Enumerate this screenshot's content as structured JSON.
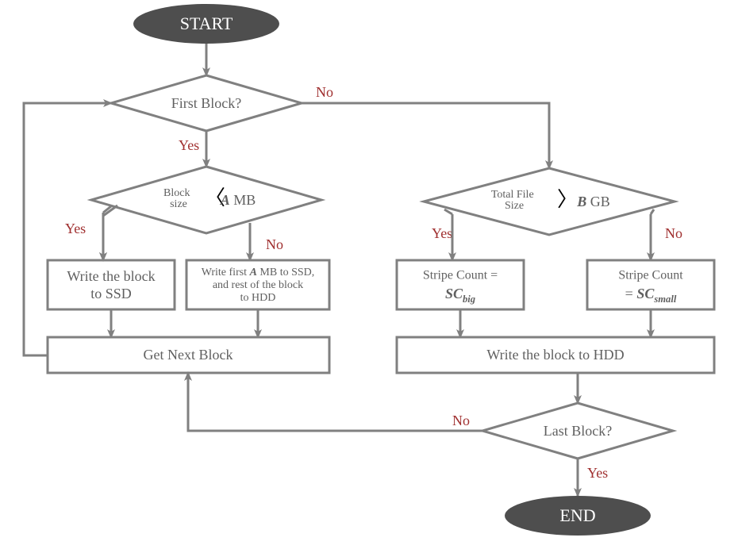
{
  "flowchart": {
    "start": "START",
    "end": "END",
    "decisions": {
      "first_block": "First Block?",
      "block_size_l1": "Block",
      "block_size_l2": "size",
      "block_size_var": "A",
      "block_size_unit": "MB",
      "total_file_l1": "Total File",
      "total_file_l2": "Size",
      "total_file_var": "B",
      "total_file_unit": "GB",
      "last_block": "Last Block?"
    },
    "processes": {
      "write_ssd_l1": "Write the block",
      "write_ssd_l2": "to SSD",
      "write_split_l1a": "Write first ",
      "write_split_l1var": "A",
      "write_split_l1b": " MB to SSD,",
      "write_split_l2": "and rest of the block",
      "write_split_l3": "to HDD",
      "sc_big_l1": "Stripe Count =",
      "sc_big_var": "SC",
      "sc_big_sub": "big",
      "sc_small_l1": "Stripe Count",
      "sc_small_eq": "= ",
      "sc_small_var": "SC",
      "sc_small_sub": "small",
      "get_next": "Get Next Block",
      "write_hdd": "Write the block to HDD"
    },
    "labels": {
      "yes": "Yes",
      "no": "No"
    }
  }
}
